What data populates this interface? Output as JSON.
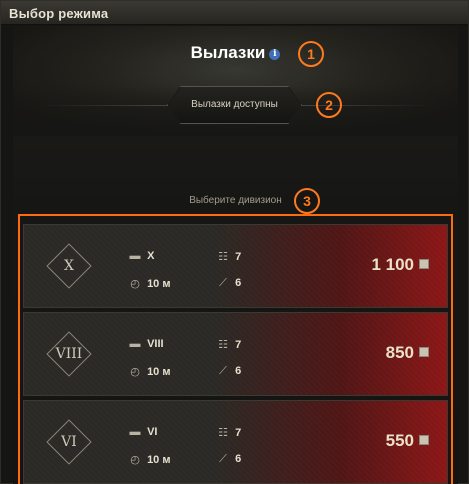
{
  "window": {
    "title": "Выбор режима"
  },
  "mode": {
    "title": "Вылазки",
    "info_icon": "i"
  },
  "status": {
    "label": "Вылазки доступны"
  },
  "prompt": {
    "label": "Выберите дивизион"
  },
  "markers": [
    "1",
    "2",
    "3"
  ],
  "divisions": [
    {
      "tier": "X",
      "tank_tier": "X",
      "players": "7",
      "time": "10 м",
      "vehicles": "6",
      "price": "1 100"
    },
    {
      "tier": "VIII",
      "tank_tier": "VIII",
      "players": "7",
      "time": "10 м",
      "vehicles": "6",
      "price": "850"
    },
    {
      "tier": "VI",
      "tank_tier": "VI",
      "players": "7",
      "time": "10 м",
      "vehicles": "6",
      "price": "550"
    }
  ],
  "colors": {
    "accent_marker": "#ff7a1c",
    "card_red": "#8c1616",
    "info_blue": "#3f6fb8"
  },
  "icons": {
    "tank": "tank-icon",
    "players": "players-icon",
    "timer": "timer-icon",
    "vehicles": "vehicles-icon",
    "currency": "gold-icon"
  }
}
